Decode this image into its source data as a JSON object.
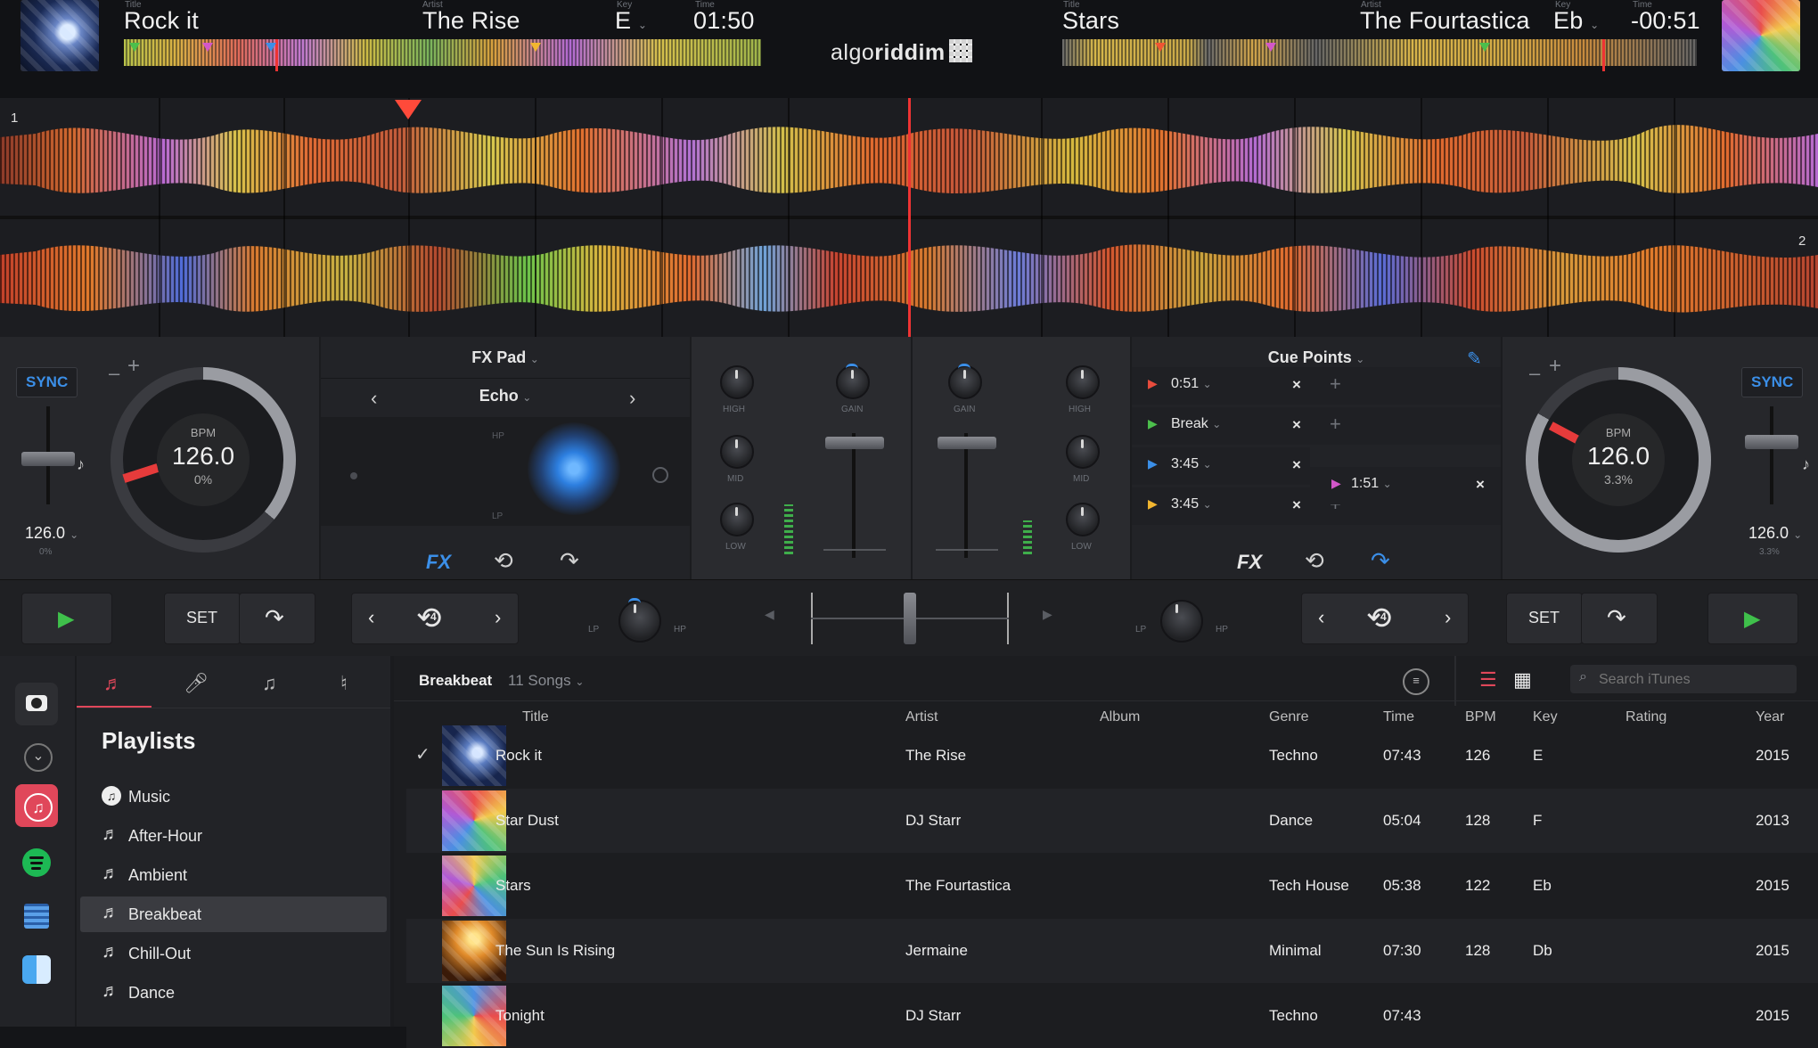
{
  "deck_a": {
    "title_label": "Title",
    "title": "Rock it",
    "artist_label": "Artist",
    "artist": "The Rise",
    "key_label": "Key",
    "key": "E",
    "time_label": "Time",
    "time": "01:50",
    "sync": "SYNC",
    "bpm_label": "BPM",
    "bpm": "126.0",
    "pitch": "0%",
    "tempo_value": "126.0",
    "tempo_pct": "0%",
    "deck_number": "1"
  },
  "deck_b": {
    "title_label": "Title",
    "title": "Stars",
    "artist_label": "Artist",
    "artist": "The Fourtastica",
    "key_label": "Key",
    "key": "Eb",
    "time_label": "Time",
    "time": "-00:51",
    "sync": "SYNC",
    "bpm_label": "BPM",
    "bpm": "126.0",
    "pitch": "3.3%",
    "tempo_value": "126.0",
    "tempo_pct": "3.3%",
    "deck_number": "2"
  },
  "logo": {
    "light": "algo",
    "bold": "riddim"
  },
  "fx_pad": {
    "header": "FX Pad",
    "effect": "Echo",
    "hp": "HP",
    "lp": "LP",
    "fx": "FX"
  },
  "mixer": {
    "high": "HIGH",
    "mid": "MID",
    "low": "LOW",
    "gain": "GAIN"
  },
  "cue_points": {
    "header": "Cue Points",
    "cues": [
      {
        "label": "0:51",
        "color": "#e84c3d"
      },
      {
        "label": "Break",
        "color": "#4cbf4c"
      },
      {
        "label": "3:45",
        "color": "#3b8fe8"
      },
      {
        "label": "3:45",
        "color": "#f2b630"
      }
    ],
    "extra_cue": {
      "label": "1:51",
      "color": "#d357c9"
    },
    "fx": "FX"
  },
  "transport": {
    "set_left": "SET",
    "set_right": "SET",
    "loop_left": "4",
    "loop_right": "4",
    "lp": "LP",
    "hp": "HP"
  },
  "library": {
    "playlists_title": "Playlists",
    "playlists": [
      "Music",
      "After-Hour",
      "Ambient",
      "Breakbeat",
      "Chill-Out",
      "Dance"
    ],
    "selected_playlist": "Breakbeat",
    "header_playlist": "Breakbeat",
    "song_count": "11 Songs",
    "search_placeholder": "Search iTunes",
    "columns": [
      "Title",
      "Artist",
      "Album",
      "Genre",
      "Time",
      "BPM",
      "Key",
      "Rating",
      "Year"
    ],
    "tracks": [
      {
        "title": "Rock it",
        "artist": "The Rise",
        "album": "",
        "genre": "Techno",
        "time": "07:43",
        "bpm": "126",
        "key": "E",
        "rating": "",
        "year": "2015",
        "checked": "✓"
      },
      {
        "title": "Star Dust",
        "artist": "DJ Starr",
        "album": "",
        "genre": "Dance",
        "time": "05:04",
        "bpm": "128",
        "key": "F",
        "rating": "",
        "year": "2013",
        "checked": ""
      },
      {
        "title": "Stars",
        "artist": "The Fourtastica",
        "album": "",
        "genre": "Tech House",
        "time": "05:38",
        "bpm": "122",
        "key": "Eb",
        "rating": "",
        "year": "2015",
        "checked": ""
      },
      {
        "title": "The Sun Is Rising",
        "artist": "Jermaine",
        "album": "",
        "genre": "Minimal",
        "time": "07:30",
        "bpm": "128",
        "key": "Db",
        "rating": "",
        "year": "2015",
        "checked": ""
      },
      {
        "title": "Tonight",
        "artist": "DJ Starr",
        "album": "",
        "genre": "Techno",
        "time": "07:43",
        "bpm": "",
        "key": "",
        "rating": "",
        "year": "2015",
        "checked": ""
      }
    ]
  },
  "colors": {
    "accent": "#3b8fe8",
    "playhead": "#e33333",
    "itunes": "#e0475a",
    "spotify": "#1db954"
  },
  "icons": [
    "music-note-icon",
    "pencil-icon",
    "loop-icon",
    "redo-icon",
    "play-icon",
    "filter-icon",
    "list-view-icon",
    "grid-view-icon",
    "search-icon"
  ]
}
